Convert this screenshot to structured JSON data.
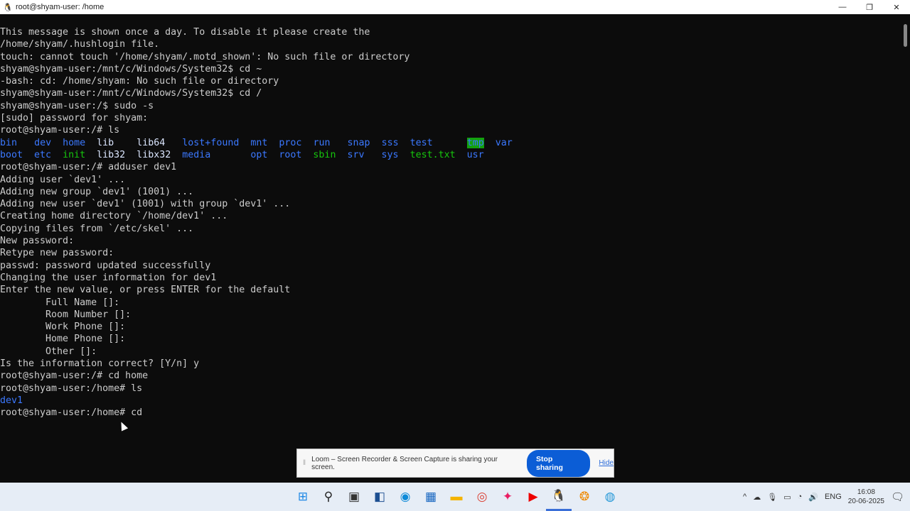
{
  "window": {
    "title": "root@shyam-user: /home",
    "controls": [
      "—",
      "❐",
      "✕"
    ]
  },
  "terminal": {
    "lines": [
      [
        {
          "t": "This message is shown once a day. To disable it please create the"
        }
      ],
      [
        {
          "t": "/home/shyam/.hushlogin file."
        }
      ],
      [
        {
          "t": "touch: cannot touch '/home/shyam/.motd_shown': No such file or directory"
        }
      ],
      [
        {
          "t": "shyam@shyam-user:/mnt/c/Windows/System32$ cd ~"
        }
      ],
      [
        {
          "t": "-bash: cd: /home/shyam: No such file or directory"
        }
      ],
      [
        {
          "t": "shyam@shyam-user:/mnt/c/Windows/System32$ cd /"
        }
      ],
      [
        {
          "t": "shyam@shyam-user:/$ sudo -s"
        }
      ],
      [
        {
          "t": "[sudo] password for shyam:"
        }
      ],
      [
        {
          "t": "root@shyam-user:/# ls"
        }
      ],
      [
        {
          "t": "bin",
          "c": "blue"
        },
        {
          "t": "   "
        },
        {
          "t": "dev",
          "c": "blue"
        },
        {
          "t": "  "
        },
        {
          "t": "home",
          "c": "blue"
        },
        {
          "t": "  "
        },
        {
          "t": "lib",
          "c": "cyan"
        },
        {
          "t": "    "
        },
        {
          "t": "lib64",
          "c": "cyan"
        },
        {
          "t": "   "
        },
        {
          "t": "lost+found",
          "c": "blue"
        },
        {
          "t": "  "
        },
        {
          "t": "mnt",
          "c": "blue"
        },
        {
          "t": "  "
        },
        {
          "t": "proc",
          "c": "blue"
        },
        {
          "t": "  "
        },
        {
          "t": "run",
          "c": "blue"
        },
        {
          "t": "   "
        },
        {
          "t": "snap",
          "c": "blue"
        },
        {
          "t": "  "
        },
        {
          "t": "sss",
          "c": "blue"
        },
        {
          "t": "  "
        },
        {
          "t": "test",
          "c": "blue"
        },
        {
          "t": "      "
        },
        {
          "t": "tmp",
          "c": "bgg"
        },
        {
          "t": "  "
        },
        {
          "t": "var",
          "c": "blue"
        }
      ],
      [
        {
          "t": "boot",
          "c": "blue"
        },
        {
          "t": "  "
        },
        {
          "t": "etc",
          "c": "blue"
        },
        {
          "t": "  "
        },
        {
          "t": "init",
          "c": "green"
        },
        {
          "t": "  "
        },
        {
          "t": "lib32",
          "c": "cyan"
        },
        {
          "t": "  "
        },
        {
          "t": "libx32",
          "c": "cyan"
        },
        {
          "t": "  "
        },
        {
          "t": "media",
          "c": "blue"
        },
        {
          "t": "       "
        },
        {
          "t": "opt",
          "c": "blue"
        },
        {
          "t": "  "
        },
        {
          "t": "root",
          "c": "blue"
        },
        {
          "t": "  "
        },
        {
          "t": "sbin",
          "c": "green"
        },
        {
          "t": "  "
        },
        {
          "t": "srv",
          "c": "blue"
        },
        {
          "t": "   "
        },
        {
          "t": "sys",
          "c": "blue"
        },
        {
          "t": "  "
        },
        {
          "t": "test.txt",
          "c": "green"
        },
        {
          "t": "  "
        },
        {
          "t": "usr",
          "c": "blue"
        }
      ],
      [
        {
          "t": "root@shyam-user:/# adduser dev1"
        }
      ],
      [
        {
          "t": "Adding user `dev1' ..."
        }
      ],
      [
        {
          "t": "Adding new group `dev1' (1001) ..."
        }
      ],
      [
        {
          "t": "Adding new user `dev1' (1001) with group `dev1' ..."
        }
      ],
      [
        {
          "t": "Creating home directory `/home/dev1' ..."
        }
      ],
      [
        {
          "t": "Copying files from `/etc/skel' ..."
        }
      ],
      [
        {
          "t": "New password:"
        }
      ],
      [
        {
          "t": "Retype new password:"
        }
      ],
      [
        {
          "t": "passwd: password updated successfully"
        }
      ],
      [
        {
          "t": "Changing the user information for dev1"
        }
      ],
      [
        {
          "t": "Enter the new value, or press ENTER for the default"
        }
      ],
      [
        {
          "t": "        Full Name []:"
        }
      ],
      [
        {
          "t": "        Room Number []:"
        }
      ],
      [
        {
          "t": "        Work Phone []:"
        }
      ],
      [
        {
          "t": "        Home Phone []:"
        }
      ],
      [
        {
          "t": "        Other []:"
        }
      ],
      [
        {
          "t": "Is the information correct? [Y/n] y"
        }
      ],
      [
        {
          "t": "root@shyam-user:/# cd home"
        }
      ],
      [
        {
          "t": "root@shyam-user:/home# ls"
        }
      ],
      [
        {
          "t": "dev1",
          "c": "blue"
        }
      ],
      [
        {
          "t": "root@shyam-user:/home# cd "
        }
      ]
    ]
  },
  "loom": {
    "message": "Loom – Screen Recorder & Screen Capture is sharing your screen.",
    "stop_label": "Stop sharing",
    "hide_label": "Hide"
  },
  "taskbar": {
    "apps": [
      {
        "name": "start",
        "glyph": "⊞",
        "color": "#1e88e5"
      },
      {
        "name": "search",
        "glyph": "⚲",
        "color": "#222"
      },
      {
        "name": "task-view",
        "glyph": "▣",
        "color": "#333"
      },
      {
        "name": "widgets",
        "glyph": "◧",
        "color": "#1d4f91"
      },
      {
        "name": "edge",
        "glyph": "◉",
        "color": "#0e8ad8"
      },
      {
        "name": "store",
        "glyph": "▦",
        "color": "#1565c0"
      },
      {
        "name": "file-explorer",
        "glyph": "▬",
        "color": "#f4b400"
      },
      {
        "name": "chrome",
        "glyph": "◎",
        "color": "#db4437"
      },
      {
        "name": "photos",
        "glyph": "✦",
        "color": "#e91e63"
      },
      {
        "name": "youtube",
        "glyph": "▶",
        "color": "#e00"
      },
      {
        "name": "linux",
        "glyph": "🐧",
        "color": "#000"
      },
      {
        "name": "app-orange",
        "glyph": "❂",
        "color": "#f08a00"
      },
      {
        "name": "browser-globe",
        "glyph": "◍",
        "color": "#2a9ad8"
      }
    ],
    "tray": {
      "chevron": "^",
      "language": "ENG",
      "time": "16:08",
      "date": "20-06-2025"
    }
  }
}
